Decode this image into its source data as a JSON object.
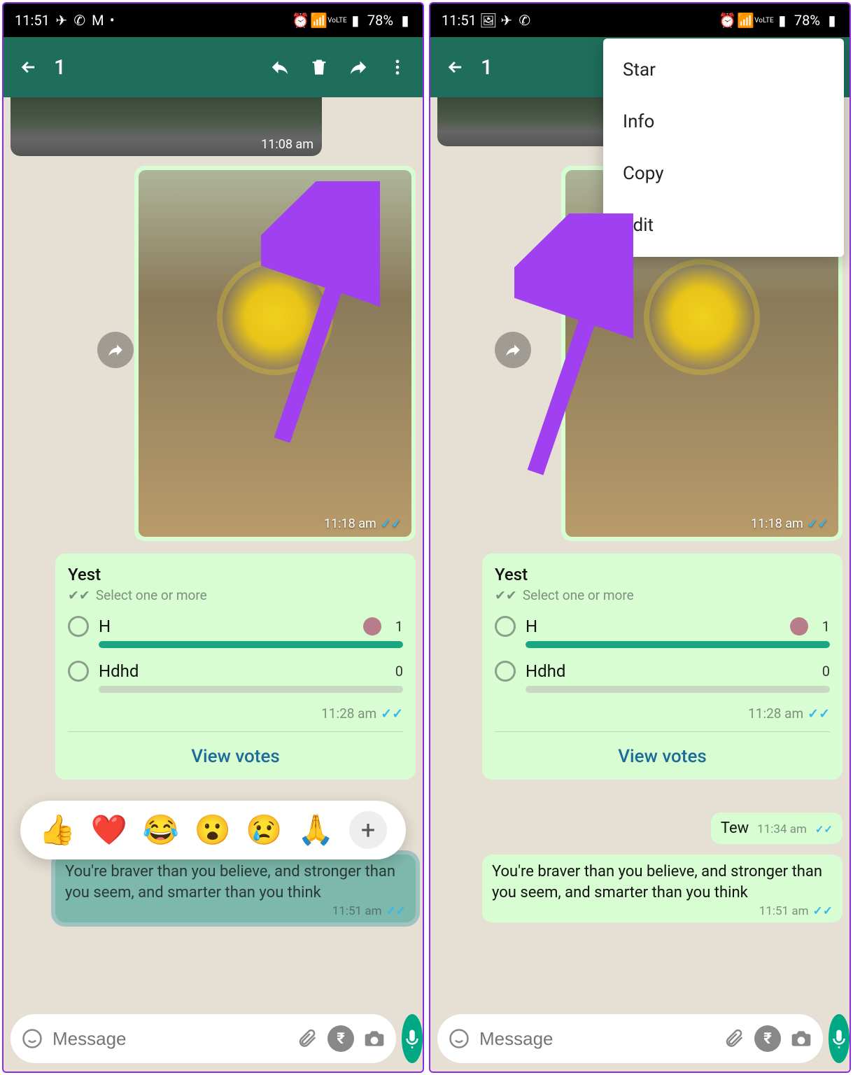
{
  "statusbar": {
    "time": "11:51",
    "battery": "78%"
  },
  "appbar": {
    "selection_count": "1"
  },
  "messages": {
    "photo_top_time": "11:08 am",
    "photo_main_time": "11:18 am",
    "tew_text": "Tew",
    "tew_time": "11:34 am",
    "quote_text": "You're braver than you believe, and stronger than you seem, and smarter than you think",
    "quote_time": "11:51 am"
  },
  "poll": {
    "title": "Yest",
    "hint": "Select one or more",
    "options": [
      {
        "label": "H",
        "count": "1",
        "percent": 100
      },
      {
        "label": "Hdhd",
        "count": "0",
        "percent": 0
      }
    ],
    "time": "11:28 am",
    "view_label": "View votes"
  },
  "input": {
    "placeholder": "Message"
  },
  "reactions": [
    "👍",
    "❤️",
    "😂",
    "😮",
    "😢",
    "🙏"
  ],
  "overflow_menu": [
    "Star",
    "Info",
    "Copy",
    "Edit"
  ]
}
